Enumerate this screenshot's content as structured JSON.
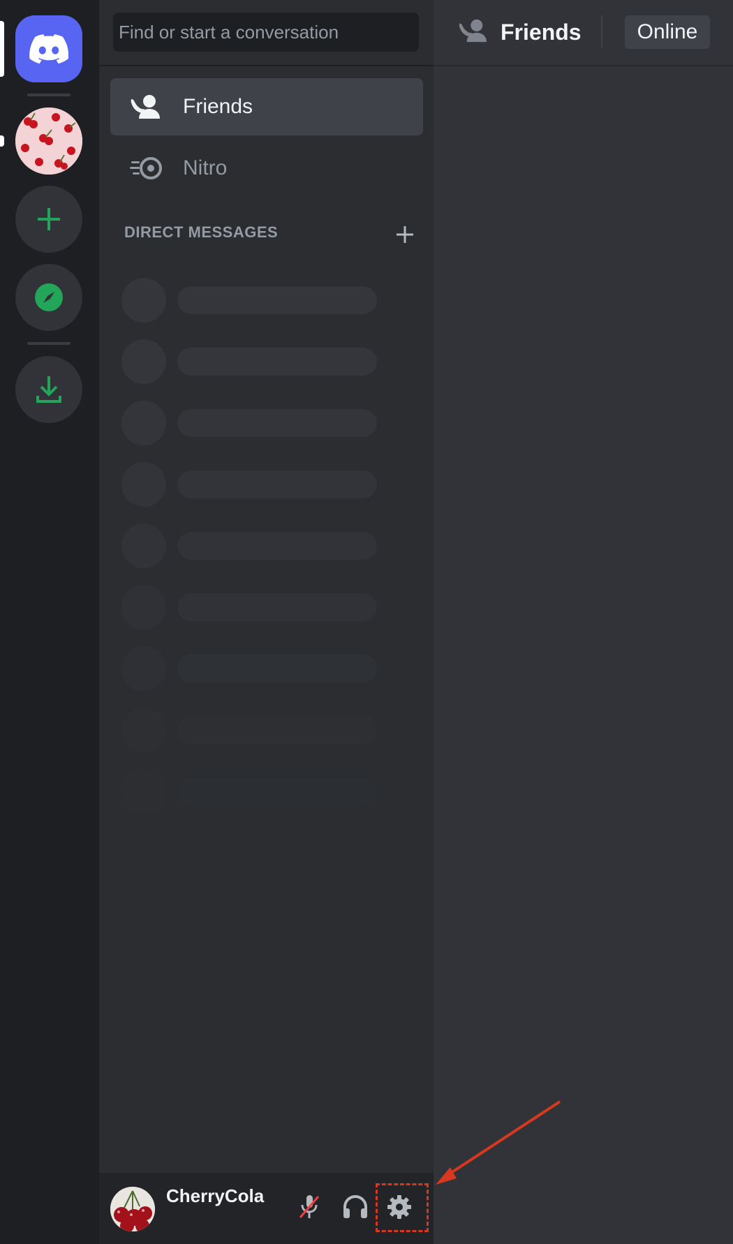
{
  "search": {
    "placeholder": "Find or start a conversation"
  },
  "nav": {
    "friends_label": "Friends",
    "nitro_label": "Nitro"
  },
  "dm": {
    "header": "DIRECT MESSAGES",
    "add_icon": "plus-icon"
  },
  "user": {
    "username": "CherryCola",
    "mic_icon": "microphone-muted-icon",
    "headset_icon": "headphones-icon",
    "settings_icon": "gear-icon"
  },
  "main_header": {
    "title": "Friends",
    "tab_online": "Online"
  },
  "colors": {
    "blurple": "#5865f2",
    "green": "#23a55a",
    "annotation_red": "#d8381e",
    "muted_red": "#f23f43"
  }
}
